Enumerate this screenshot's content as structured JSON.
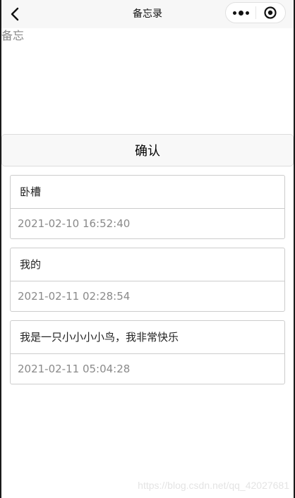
{
  "navbar": {
    "title": "备忘录",
    "back_icon": "chevron-left-icon",
    "more_icon": "more-dots-icon",
    "close_icon": "target-circle-icon"
  },
  "memo": {
    "placeholder": "备忘",
    "value": ""
  },
  "confirm": {
    "label": "确认"
  },
  "memos": [
    {
      "text": "卧槽",
      "time": "2021-02-10 16:52:40"
    },
    {
      "text": "我的",
      "time": "2021-02-11 02:28:54"
    },
    {
      "text": "我是一只小小小小鸟，我非常快乐",
      "time": "2021-02-11 05:04:28"
    }
  ],
  "watermark": "https://blog.csdn.net/qq_42027681"
}
